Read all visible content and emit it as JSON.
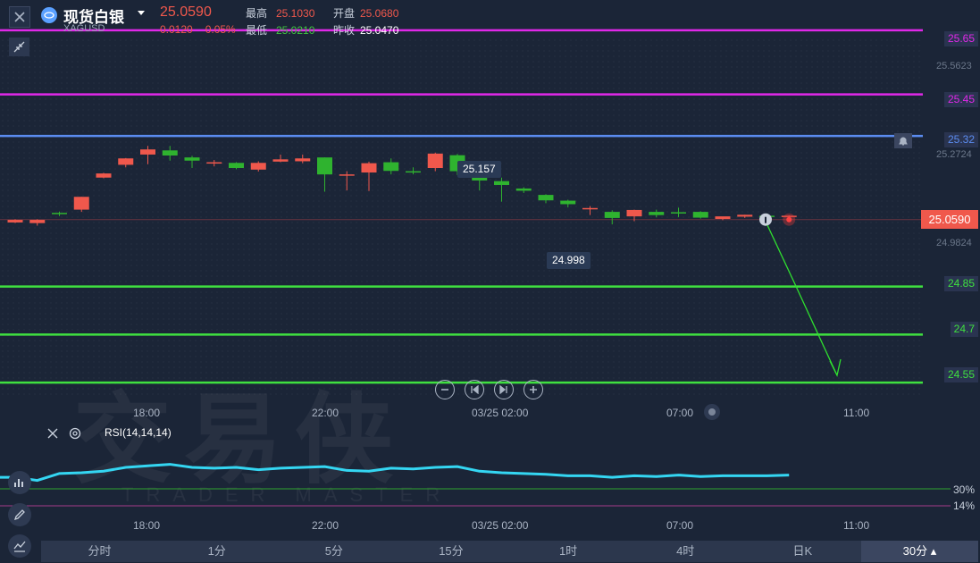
{
  "header": {
    "title": "现货白银",
    "code": "XAGUSD",
    "price": "25.0590",
    "change": "0.0120",
    "change_pct": "0.05%",
    "high_label": "最高",
    "high": "25.1030",
    "open_label": "开盘",
    "open": "25.0680",
    "low_label": "最低",
    "low": "25.0210",
    "prev_label": "昨收",
    "prev_close": "25.0470"
  },
  "price_axis": {
    "levels": [
      {
        "label": "25.65",
        "color": "#e028e8"
      },
      {
        "label": "25.45",
        "color": "#e028e8"
      },
      {
        "label": "25.32",
        "color": "#5b8cf0"
      },
      {
        "label": "24.85",
        "color": "#3fe03f"
      },
      {
        "label": "24.7",
        "color": "#3fe03f"
      },
      {
        "label": "24.55",
        "color": "#3fe03f"
      }
    ],
    "ticks": [
      "25.5623",
      "25.2724",
      "24.9824"
    ],
    "current": "25.0590"
  },
  "chart_data": {
    "type": "candlestick",
    "ylim": [
      24.5,
      25.7
    ],
    "candles": [
      {
        "o": 25.05,
        "h": 25.06,
        "l": 25.048,
        "c": 25.058
      },
      {
        "o": 25.048,
        "h": 25.06,
        "l": 25.04,
        "c": 25.058
      },
      {
        "o": 25.08,
        "h": 25.084,
        "l": 25.07,
        "c": 25.076
      },
      {
        "o": 25.09,
        "h": 25.13,
        "l": 25.083,
        "c": 25.13
      },
      {
        "o": 25.19,
        "h": 25.205,
        "l": 25.188,
        "c": 25.203
      },
      {
        "o": 25.23,
        "h": 25.251,
        "l": 25.222,
        "c": 25.25
      },
      {
        "o": 25.262,
        "h": 25.289,
        "l": 25.232,
        "c": 25.278
      },
      {
        "o": 25.275,
        "h": 25.289,
        "l": 25.243,
        "c": 25.259
      },
      {
        "o": 25.253,
        "h": 25.258,
        "l": 25.22,
        "c": 25.243
      },
      {
        "o": 25.235,
        "h": 25.245,
        "l": 25.225,
        "c": 25.238
      },
      {
        "o": 25.236,
        "h": 25.238,
        "l": 25.216,
        "c": 25.22
      },
      {
        "o": 25.215,
        "h": 25.241,
        "l": 25.209,
        "c": 25.236
      },
      {
        "o": 25.24,
        "h": 25.262,
        "l": 25.238,
        "c": 25.247
      },
      {
        "o": 25.241,
        "h": 25.262,
        "l": 25.235,
        "c": 25.25
      },
      {
        "o": 25.253,
        "h": 25.253,
        "l": 25.146,
        "c": 25.2
      },
      {
        "o": 25.2,
        "h": 25.21,
        "l": 25.15,
        "c": 25.2
      },
      {
        "o": 25.206,
        "h": 25.24,
        "l": 25.148,
        "c": 25.235
      },
      {
        "o": 25.238,
        "h": 25.25,
        "l": 25.2,
        "c": 25.211
      },
      {
        "o": 25.21,
        "h": 25.222,
        "l": 25.2,
        "c": 25.208
      },
      {
        "o": 25.22,
        "h": 25.268,
        "l": 25.21,
        "c": 25.265
      },
      {
        "o": 25.26,
        "h": 25.264,
        "l": 25.198,
        "c": 25.21
      },
      {
        "o": 25.21,
        "h": 25.21,
        "l": 25.15,
        "c": 25.181
      },
      {
        "o": 25.179,
        "h": 25.19,
        "l": 25.115,
        "c": 25.167
      },
      {
        "o": 25.156,
        "h": 25.16,
        "l": 25.142,
        "c": 25.149
      },
      {
        "o": 25.136,
        "h": 25.138,
        "l": 25.11,
        "c": 25.119
      },
      {
        "o": 25.118,
        "h": 25.121,
        "l": 25.097,
        "c": 25.107
      },
      {
        "o": 25.094,
        "h": 25.101,
        "l": 25.073,
        "c": 25.095
      },
      {
        "o": 25.083,
        "h": 25.088,
        "l": 25.044,
        "c": 25.064
      },
      {
        "o": 25.069,
        "h": 25.09,
        "l": 25.054,
        "c": 25.089
      },
      {
        "o": 25.083,
        "h": 25.09,
        "l": 25.066,
        "c": 25.073
      },
      {
        "o": 25.082,
        "h": 25.096,
        "l": 25.067,
        "c": 25.08
      },
      {
        "o": 25.083,
        "h": 25.085,
        "l": 25.062,
        "c": 25.065
      },
      {
        "o": 25.061,
        "h": 25.068,
        "l": 25.057,
        "c": 25.069
      },
      {
        "o": 25.068,
        "h": 25.074,
        "l": 25.064,
        "c": 25.074
      },
      {
        "o": 25.071,
        "h": 25.078,
        "l": 25.066,
        "c": 25.069
      },
      {
        "o": 25.07,
        "h": 25.072,
        "l": 25.066,
        "c": 25.071
      }
    ],
    "rsi": [
      40,
      36,
      45,
      46,
      48,
      53,
      55,
      57,
      53,
      52,
      53,
      50,
      52,
      53,
      54,
      49,
      48,
      52,
      51,
      53,
      54,
      48,
      46,
      45,
      44,
      42,
      42,
      40,
      42,
      41,
      43,
      41,
      42,
      42,
      42,
      43
    ],
    "rsi_levels": [
      "30%",
      "14%"
    ],
    "x_ticks": [
      "18:00",
      "22:00",
      "03/25 02:00",
      "07:00",
      "11:00"
    ]
  },
  "callouts": {
    "high_marker": "25.157",
    "low_marker": "24.998"
  },
  "rsi": {
    "label": "RSI(14,14,14)"
  },
  "colors": {
    "up": "#f0584c",
    "down": "#2fb32f",
    "background": "#1b2537",
    "rsi_line": "#34d6f2"
  },
  "tabs": [
    "分时",
    "1分",
    "5分",
    "15分",
    "1时",
    "4时",
    "日K",
    "30分"
  ],
  "active_tab": "30分"
}
